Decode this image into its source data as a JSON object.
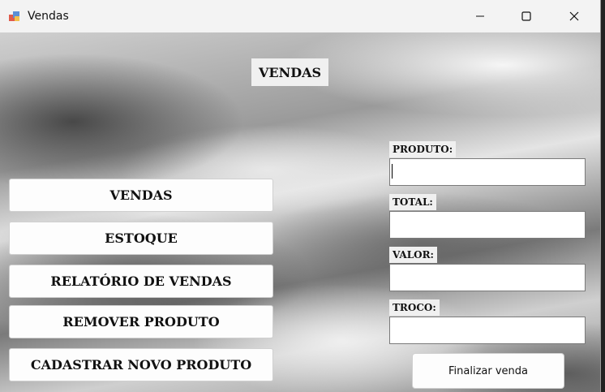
{
  "window": {
    "title": "Vendas"
  },
  "page": {
    "title": "VENDAS"
  },
  "nav": {
    "vendas": "VENDAS",
    "estoque": "ESTOQUE",
    "relatorio": "RELATÓRIO DE VENDAS",
    "remover": "REMOVER PRODUTO",
    "cadastrar": "CADASTRAR NOVO PRODUTO"
  },
  "form": {
    "produto_label": "PRODUTO:",
    "produto_value": "",
    "total_label": "TOTAL:",
    "total_value": "",
    "valor_label": "VALOR:",
    "valor_value": "",
    "troco_label": "TROCO:",
    "troco_value": ""
  },
  "actions": {
    "finalizar": "Finalizar venda"
  },
  "icons": {
    "app": "app-icon",
    "minimize": "minimize-icon",
    "maximize": "maximize-icon",
    "close": "close-icon"
  }
}
